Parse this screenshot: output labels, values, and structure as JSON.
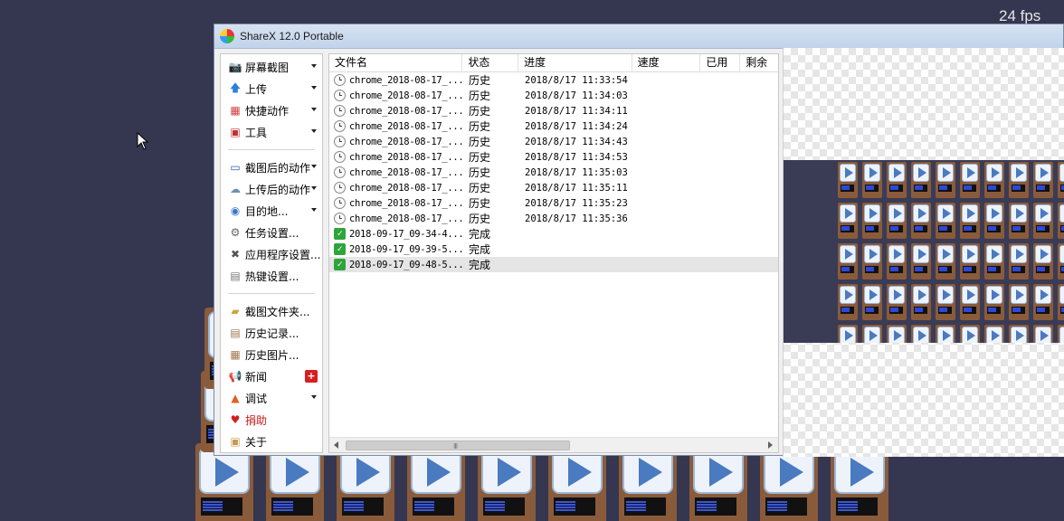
{
  "overlay": {
    "fps_label": "24 fps"
  },
  "window": {
    "title": "ShareX 12.0 Portable"
  },
  "sidebar": {
    "items": [
      {
        "label": "屏幕截图",
        "icon": "camera-icon",
        "has_dropdown": true
      },
      {
        "label": "上传",
        "icon": "upload-arrow-icon",
        "has_dropdown": true
      },
      {
        "label": "快捷动作",
        "icon": "grid-icon",
        "has_dropdown": true
      },
      {
        "label": "工具",
        "icon": "toolbox-icon",
        "has_dropdown": true
      },
      {
        "label": "截图后的动作",
        "icon": "monitor-icon",
        "has_dropdown": true
      },
      {
        "label": "上传后的动作",
        "icon": "cloud-icon",
        "has_dropdown": true
      },
      {
        "label": "目的地...",
        "icon": "globe-icon",
        "has_dropdown": true
      },
      {
        "label": "任务设置...",
        "icon": "gear-icon",
        "has_dropdown": false
      },
      {
        "label": "应用程序设置...",
        "icon": "wrench-icon",
        "has_dropdown": false
      },
      {
        "label": "热键设置...",
        "icon": "keyboard-icon",
        "has_dropdown": false
      },
      {
        "label": "截图文件夹...",
        "icon": "folder-icon",
        "has_dropdown": false
      },
      {
        "label": "历史记录...",
        "icon": "history-icon",
        "has_dropdown": false
      },
      {
        "label": "历史图片...",
        "icon": "image-history-icon",
        "has_dropdown": false
      },
      {
        "label": "新闻",
        "icon": "megaphone-icon",
        "has_dropdown": false,
        "badge": "+"
      },
      {
        "label": "调试",
        "icon": "cone-icon",
        "has_dropdown": true
      },
      {
        "label": "捐助",
        "icon": "heart-icon",
        "has_dropdown": false
      },
      {
        "label": "关于",
        "icon": "box-icon",
        "has_dropdown": false
      }
    ]
  },
  "list": {
    "columns": [
      "文件名",
      "状态",
      "进度",
      "速度",
      "已用",
      "剩余"
    ],
    "rows": [
      {
        "name": "chrome_2018-08-17_...",
        "status": "历史",
        "progress": "2018/8/17 11:33:54",
        "icon": "history-icon"
      },
      {
        "name": "chrome_2018-08-17_...",
        "status": "历史",
        "progress": "2018/8/17 11:34:03",
        "icon": "history-icon"
      },
      {
        "name": "chrome_2018-08-17_...",
        "status": "历史",
        "progress": "2018/8/17 11:34:11",
        "icon": "history-icon"
      },
      {
        "name": "chrome_2018-08-17_...",
        "status": "历史",
        "progress": "2018/8/17 11:34:24",
        "icon": "history-icon"
      },
      {
        "name": "chrome_2018-08-17_...",
        "status": "历史",
        "progress": "2018/8/17 11:34:43",
        "icon": "history-icon"
      },
      {
        "name": "chrome_2018-08-17_...",
        "status": "历史",
        "progress": "2018/8/17 11:34:53",
        "icon": "history-icon"
      },
      {
        "name": "chrome_2018-08-17_...",
        "status": "历史",
        "progress": "2018/8/17 11:35:03",
        "icon": "history-icon"
      },
      {
        "name": "chrome_2018-08-17_...",
        "status": "历史",
        "progress": "2018/8/17 11:35:11",
        "icon": "history-icon"
      },
      {
        "name": "chrome_2018-08-17_...",
        "status": "历史",
        "progress": "2018/8/17 11:35:23",
        "icon": "history-icon"
      },
      {
        "name": "chrome_2018-08-17_...",
        "status": "历史",
        "progress": "2018/8/17 11:35:36",
        "icon": "history-icon"
      },
      {
        "name": "2018-09-17_09-34-4...",
        "status": "完成",
        "progress": "",
        "icon": "check-icon"
      },
      {
        "name": "2018-09-17_09-39-5...",
        "status": "完成",
        "progress": "",
        "icon": "check-icon"
      },
      {
        "name": "2018-09-17_09-48-5...",
        "status": "完成",
        "progress": "",
        "icon": "check-icon"
      }
    ],
    "selected_index": 12,
    "scroll_grip": "III"
  },
  "colors": {
    "desktop": "#353650",
    "selected_row": "#e5e5e5",
    "donate_text": "#c81818",
    "done_icon": "#2ea43a"
  }
}
